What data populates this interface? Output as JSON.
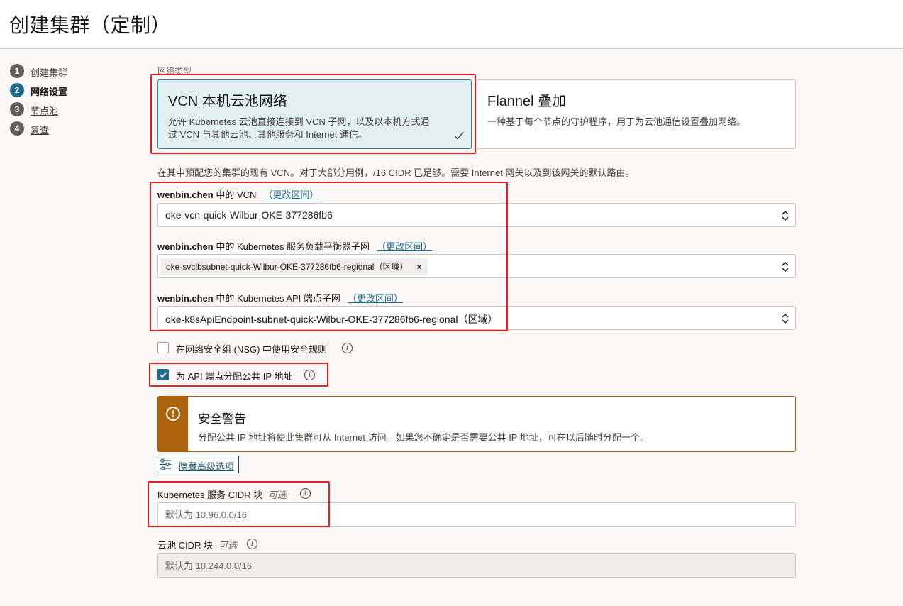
{
  "page": {
    "title": "创建集群（定制）"
  },
  "steps": [
    {
      "num": "1",
      "label": "创建集群"
    },
    {
      "num": "2",
      "label": "网络设置"
    },
    {
      "num": "3",
      "label": "节点池"
    },
    {
      "num": "4",
      "label": "复查"
    }
  ],
  "network_type": {
    "label": "网络类型",
    "options": [
      {
        "title": "VCN 本机云池网络",
        "desc_line1": "允许 Kubernetes 云池直接连接到 VCN 子网，以及以本机方式通",
        "desc_line2": "过 VCN 与其他云池、其他服务和 Internet 通信。",
        "selected": true
      },
      {
        "title": "Flannel 叠加",
        "desc_line1": "一种基于每个节点的守护程序，用于为云池通信设置叠加网络。",
        "selected": false
      }
    ]
  },
  "helper_text": "在其中预配您的集群的现有 VCN。对于大部分用例，/16 CIDR 已足够。需要 Internet 网关以及到该网关的默认路由。",
  "vcn": {
    "owner": "wenbin.chen",
    "label_suffix": " 中的 VCN",
    "change_link": "（更改区间）",
    "value": "oke-vcn-quick-Wilbur-OKE-377286fb6"
  },
  "lb_subnet": {
    "owner": "wenbin.chen",
    "label_suffix": " 中的 Kubernetes 服务负载平衡器子网",
    "change_link": "（更改区间）",
    "chip": "oke-svclbsubnet-quick-Wilbur-OKE-377286fb6-regional（区域）",
    "chip_remove": "×"
  },
  "api_subnet": {
    "owner": "wenbin.chen",
    "label_suffix": " 中的 Kubernetes API 端点子网",
    "change_link": "（更改区间）",
    "value": "oke-k8sApiEndpoint-subnet-quick-Wilbur-OKE-377286fb6-regional（区域）"
  },
  "nsg_checkbox": {
    "label": "在网络安全组 (NSG) 中使用安全规则",
    "checked": false
  },
  "public_ip_checkbox": {
    "label": "为 API 端点分配公共 IP 地址",
    "checked": true
  },
  "warning": {
    "icon": "!",
    "title": "安全警告",
    "text": "分配公共 IP 地址将使此集群可从 Internet 访问。如果您不确定是否需要公共 IP 地址，可在以后随时分配一个。"
  },
  "advanced_button": {
    "label": "隐藏高级选项"
  },
  "services_cidr": {
    "label": "Kubernetes 服务 CIDR 块",
    "optional": "可选",
    "placeholder": "默认为 10.96.0.0/16"
  },
  "pods_cidr": {
    "label": "云池 CIDR 块",
    "optional": "可选",
    "placeholder": "默认为 10.244.0.0/16"
  },
  "colors": {
    "accent": "#1e6a8c",
    "warning": "#ac630c",
    "highlight": "#e81f1f"
  }
}
